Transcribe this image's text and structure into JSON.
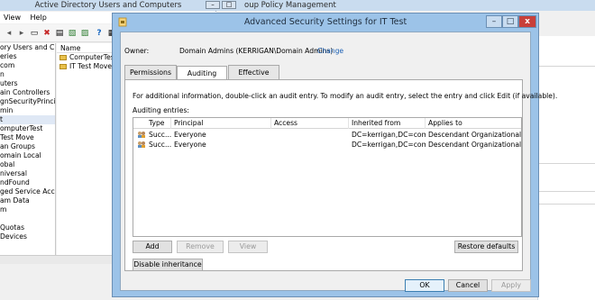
{
  "ad_window": {
    "title": "Active Directory Users and Computers",
    "menu": [
      "View",
      "Help"
    ],
    "tree_items": [
      "ory Users and C",
      "eries",
      "com",
      "n",
      "uters",
      "ain Controllers",
      "gnSecurityPrinci",
      "min",
      "t",
      "omputerTest",
      "Test Move",
      "an Groups",
      "omain Local",
      "obal",
      "niversal",
      "ndFound",
      "ged Service Acc",
      "am Data",
      "m",
      "",
      "Quotas",
      "Devices"
    ],
    "list_header": "Name",
    "list_items": [
      "ComputerTest",
      "IT Test Move"
    ]
  },
  "gpm_window": {
    "title": "oup Policy Management"
  },
  "dialog": {
    "title": "Advanced Security Settings for IT Test",
    "close_glyph": "x",
    "owner_label": "Owner:",
    "owner_value": "Domain Admins (KERRIGAN\\Domain Admins)",
    "owner_change": "Change",
    "tabs": [
      {
        "label": "Permissions",
        "active": false
      },
      {
        "label": "Auditing",
        "active": true
      },
      {
        "label": "Effective Access",
        "active": false
      }
    ],
    "info_text": "For additional information, double-click an audit entry. To modify an audit entry, select the entry and click Edit (if available).",
    "entries_label": "Auditing entries:",
    "columns": [
      "Type",
      "Principal",
      "Access",
      "Inherited from",
      "Applies to"
    ],
    "rows": [
      {
        "type": "Succ...",
        "principal": "Everyone",
        "access": "",
        "inherited_from": "DC=kerrigan,DC=com",
        "applies_to": "Descendant Organizational Un..."
      },
      {
        "type": "Succ...",
        "principal": "Everyone",
        "access": "",
        "inherited_from": "DC=kerrigan,DC=com",
        "applies_to": "Descendant Organizational Un..."
      }
    ],
    "buttons": {
      "add": "Add",
      "remove": "Remove",
      "view": "View",
      "restore_defaults": "Restore defaults",
      "disable_inheritance": "Disable inheritance",
      "ok": "OK",
      "cancel": "Cancel",
      "apply": "Apply"
    }
  }
}
